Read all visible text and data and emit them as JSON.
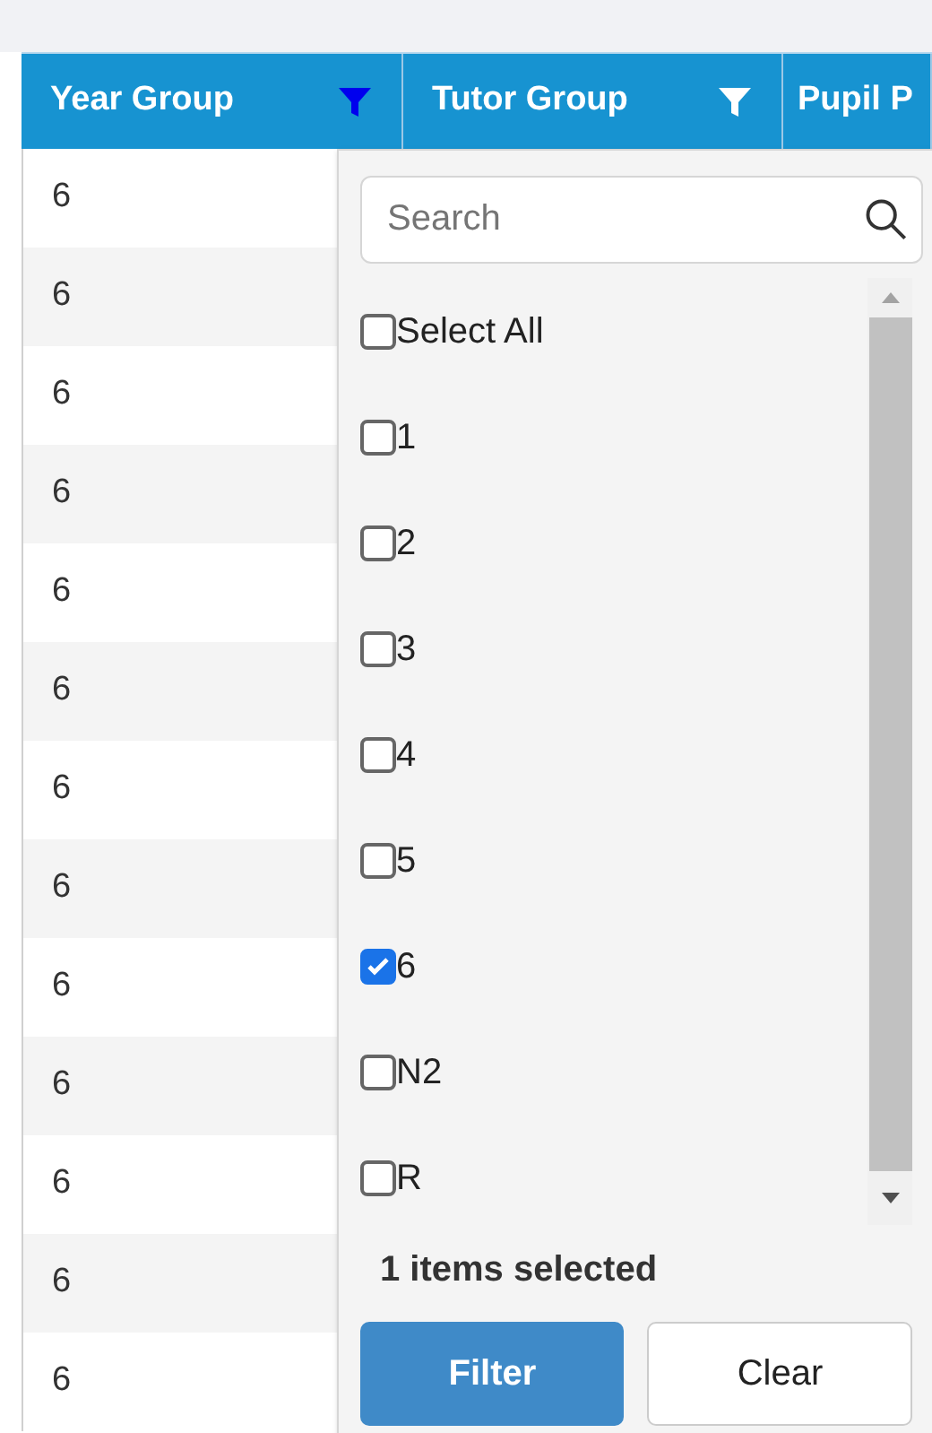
{
  "table": {
    "columns": [
      {
        "label": "Year Group",
        "filter_active": true
      },
      {
        "label": "Tutor Group",
        "filter_active": false
      },
      {
        "label": "Pupil P"
      }
    ],
    "rows": [
      "6",
      "6",
      "6",
      "6",
      "6",
      "6",
      "6",
      "6",
      "6",
      "6",
      "6",
      "6",
      "6"
    ]
  },
  "filter_popup": {
    "search": {
      "placeholder": "Search"
    },
    "options": [
      {
        "label": "Select All",
        "checked": false
      },
      {
        "label": "1",
        "checked": false
      },
      {
        "label": "2",
        "checked": false
      },
      {
        "label": "3",
        "checked": false
      },
      {
        "label": "4",
        "checked": false
      },
      {
        "label": "5",
        "checked": false
      },
      {
        "label": "6",
        "checked": true
      },
      {
        "label": "N2",
        "checked": false
      },
      {
        "label": "R",
        "checked": false
      }
    ],
    "summary": "1 items selected",
    "buttons": [
      {
        "label": "Filter",
        "kind": "primary"
      },
      {
        "label": "Clear",
        "kind": "secondary"
      }
    ]
  }
}
